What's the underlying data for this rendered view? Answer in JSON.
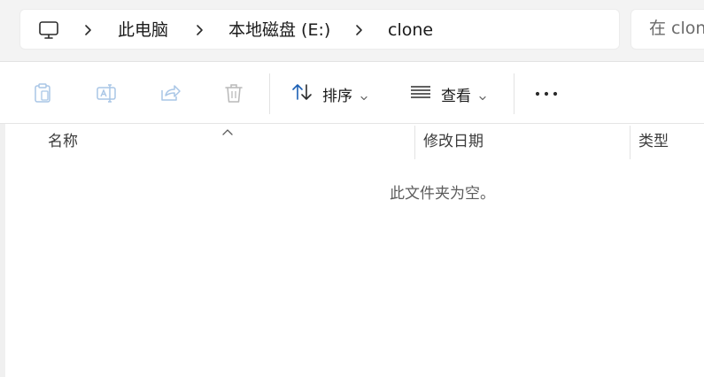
{
  "address_bar": {
    "root_icon": "monitor-icon",
    "breadcrumbs": [
      "此电脑",
      "本地磁盘 (E:)",
      "clone"
    ]
  },
  "search": {
    "placeholder": "在 clone 中搜索"
  },
  "command_bar": {
    "icons": [
      "paste-icon",
      "rename-icon",
      "share-icon",
      "delete-icon"
    ],
    "sort_label": "排序",
    "view_label": "查看",
    "more_icon": "more-dots-icon"
  },
  "columns": {
    "name": "名称",
    "modified": "修改日期",
    "type": "类型"
  },
  "empty_message": "此文件夹为空。",
  "colors": {
    "chrome_bg": "#f3f3f3",
    "disabled_icon": "#a9c6e6",
    "accent": "#1a5fb4"
  }
}
